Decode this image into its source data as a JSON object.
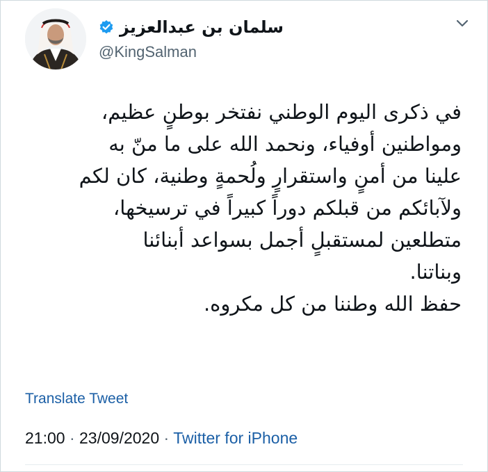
{
  "author": {
    "display_name": "سلمان بن عبدالعزيز",
    "handle": "@KingSalman",
    "verified": true
  },
  "tweet": {
    "lines": [
      "في ذكرى اليوم الوطني نفتخر بوطنٍ عظيم،",
      "ومواطنين أوفياء، ونحمد الله على ما منّ به",
      "علينا من أمنٍ واستقرارٍ ولُحمةٍ وطنية، كان لكم",
      "ولآبائكم من قبلكم دوراً كبيراً في ترسيخها،",
      "متطلعين لمستقبلٍ أجمل بسواعد أبنائنا",
      "وبناتنا.",
      "حفظ الله وطننا من كل مكروه."
    ]
  },
  "actions": {
    "translate_label": "Translate Tweet"
  },
  "meta": {
    "time": "21:00",
    "separator": "·",
    "date": "23/09/2020",
    "source": "Twitter for iPhone"
  },
  "icons": {
    "verified": "verified-badge-icon",
    "menu": "chevron-down-icon"
  },
  "colors": {
    "link": "#1b5fa6",
    "verified": "#1d9bf0",
    "secondary_text": "#536471"
  }
}
